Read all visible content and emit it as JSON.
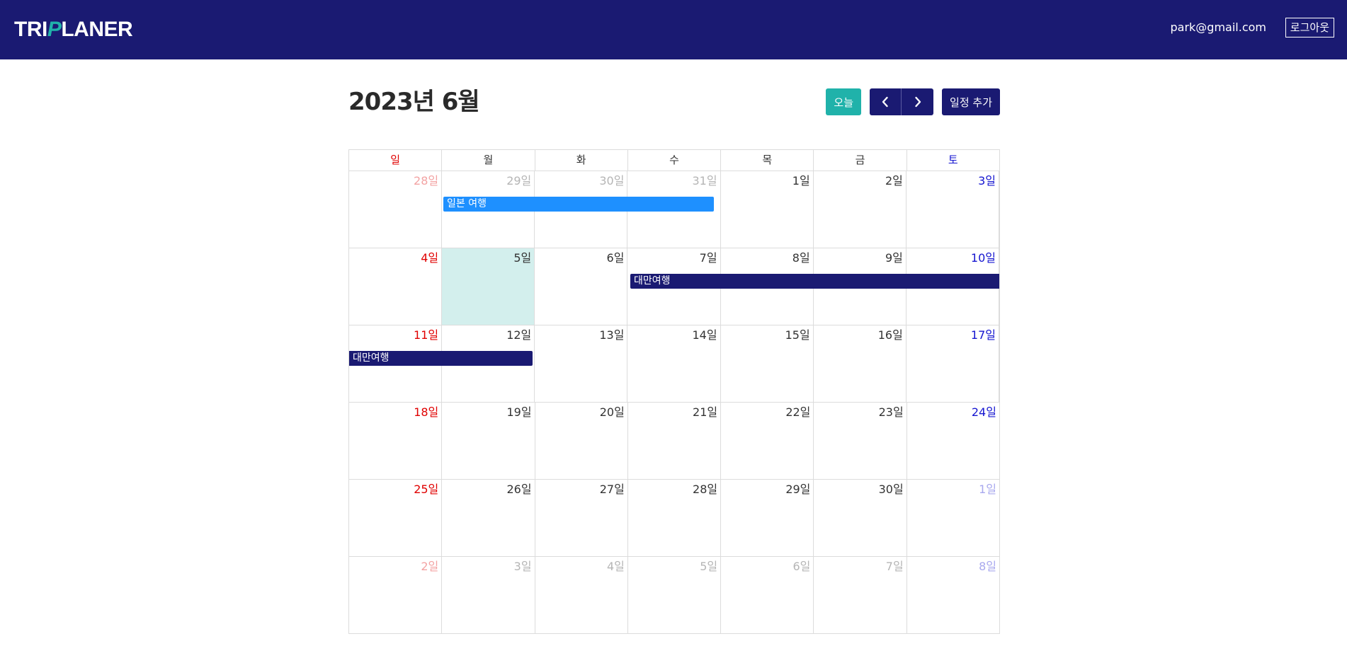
{
  "header": {
    "logo_part1": "TRI",
    "logo_accent": "P",
    "logo_part2": "LANER",
    "user_email": "park@gmail.com",
    "logout_label": "로그아웃"
  },
  "calendar": {
    "title": "2023년 6월",
    "today_label": "오늘",
    "prev_icon": "chevron-left-icon",
    "next_icon": "chevron-right-icon",
    "add_label": "일정 추가",
    "weekdays": [
      "일",
      "월",
      "화",
      "수",
      "목",
      "금",
      "토"
    ],
    "weeks": [
      [
        "28일",
        "29일",
        "30일",
        "31일",
        "1일",
        "2일",
        "3일"
      ],
      [
        "4일",
        "5일",
        "6일",
        "7일",
        "8일",
        "9일",
        "10일"
      ],
      [
        "11일",
        "12일",
        "13일",
        "14일",
        "15일",
        "16일",
        "17일"
      ],
      [
        "18일",
        "19일",
        "20일",
        "21일",
        "22일",
        "23일",
        "24일"
      ],
      [
        "25일",
        "26일",
        "27일",
        "28일",
        "29일",
        "30일",
        "1일"
      ],
      [
        "2일",
        "3일",
        "4일",
        "5일",
        "6일",
        "7일",
        "8일"
      ]
    ],
    "events": [
      {
        "title": "일본 여행",
        "color": "#1e90ff"
      },
      {
        "title": "대만여행",
        "color": "#1a1a72"
      },
      {
        "title": "대만여행",
        "color": "#1a1a72"
      }
    ]
  },
  "colors": {
    "navbar": "#1a1a72",
    "accent": "#20b2aa",
    "today_bg": "#d3efed",
    "sunday": "#e00000",
    "saturday": "#1515d0"
  }
}
